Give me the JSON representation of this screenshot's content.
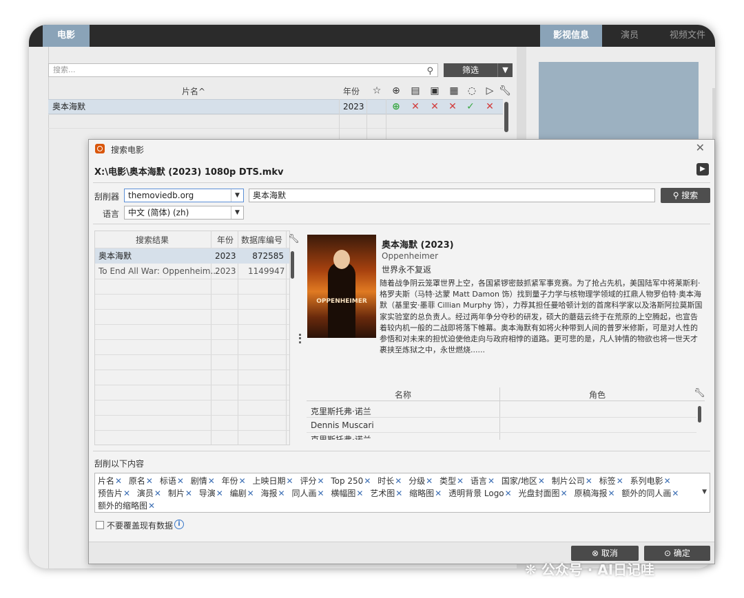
{
  "main": {
    "tabs_left": [
      "电影"
    ],
    "tabs_right": [
      "影视信息",
      "演员",
      "视频文件"
    ],
    "search_placeholder": "搜索...",
    "filter_label": "筛选",
    "columns": {
      "title": "片名^",
      "year": "年份"
    },
    "row": {
      "title": "奥本海默",
      "year": "2023"
    }
  },
  "dialog": {
    "title": "搜索电影",
    "file_path": "X:\\电影\\奥本海默 (2023) 1080p DTS.mkv",
    "scraper_label": "刮削器",
    "scraper_value": "themoviedb.org",
    "language_label": "语言",
    "language_value": "中文 (简体) (zh)",
    "query_value": "奥本海默",
    "search_button": "搜索",
    "results": {
      "headers": [
        "搜索结果",
        "年份",
        "数据库编号"
      ],
      "rows": [
        {
          "title": "奥本海默",
          "year": "2023",
          "id": "872585"
        },
        {
          "title": "To End All War: Oppenheim...",
          "year": "2023",
          "id": "1149947"
        }
      ]
    },
    "movie": {
      "title": "奥本海默 (2023)",
      "original_title": "Oppenheimer",
      "tagline": "世界永不复返",
      "plot": "随着战争阴云笼罩世界上空，各国紧锣密鼓抓紧军事竞赛。为了抢占先机，美国陆军中将莱斯利·格罗夫斯（马特·达蒙 Matt Damon 饰）找到量子力学与核物理学领域的扛鼎人物罗伯特·奥本海默（基里安·墨菲 Cillian Murphy 饰），力荐其担任曼哈顿计划的首席科学家以及洛斯阿拉莫斯国家实验室的总负责人。经过两年争分夺秒的研发，硕大的蘑菇云终于在荒原的上空腾起，也宣告着较内机一般的二战即将落下帷幕。奥本海默有如将火种带到人间的普罗米修斯，可是对人性的参悟和对未来的担忧迫使他走向与政府相悖的道路。更可悲的是，凡人钟情的物欲也将一世天才裹挟至炼狱之中，永世燃烧......",
      "poster_text": "OPPENHEIMER"
    },
    "cast": {
      "headers": [
        "名称",
        "角色"
      ],
      "rows": [
        "克里斯托弗·诺兰",
        "Dennis Muscari",
        "克里斯托弗·诺兰"
      ]
    },
    "scrape_label": "刮削以下内容",
    "tags": [
      "片名",
      "原名",
      "标语",
      "剧情",
      "年份",
      "上映日期",
      "评分",
      "Top 250",
      "时长",
      "分级",
      "类型",
      "语言",
      "国家/地区",
      "制片公司",
      "标签",
      "系列电影",
      "预告片",
      "演员",
      "制片",
      "导演",
      "编剧",
      "海报",
      "同人画",
      "横幅图",
      "艺术图",
      "缩略图",
      "透明背景 Logo",
      "光盘封面图",
      "原稿海报",
      "额外的同人画",
      "额外的缩略图"
    ],
    "no_overwrite_label": "不要覆盖现有数据",
    "cancel_button": "取消",
    "ok_button": "确定"
  },
  "watermark": "公众号 · AI日记哇"
}
